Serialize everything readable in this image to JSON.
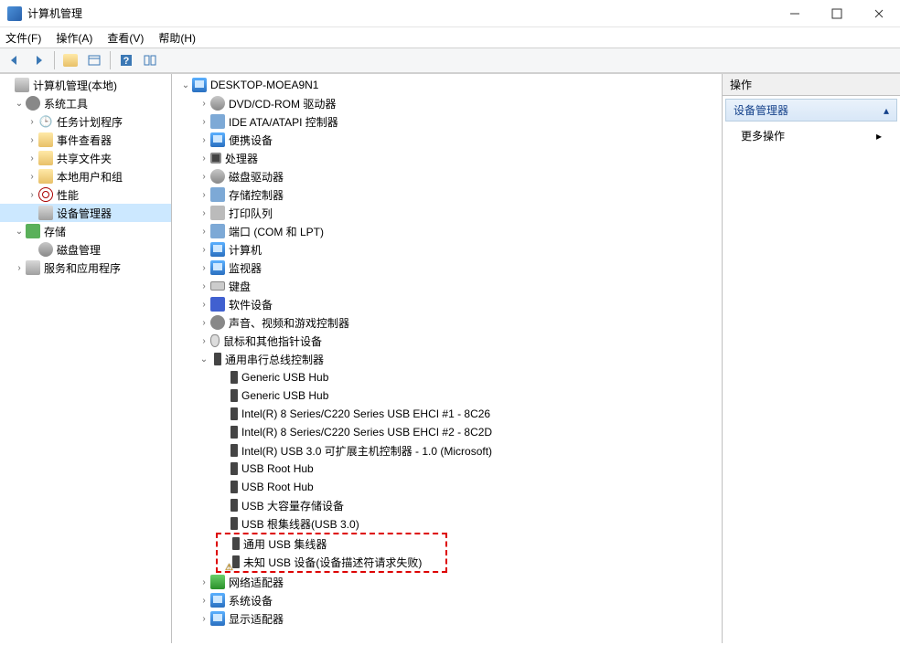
{
  "window": {
    "title": "计算机管理"
  },
  "menu": {
    "file": "文件(F)",
    "action": "操作(A)",
    "view": "查看(V)",
    "help": "帮助(H)"
  },
  "toolbar_icons": {
    "back": "back-arrow",
    "forward": "forward-arrow",
    "up": "up-folder",
    "properties": "properties",
    "help": "help",
    "refresh": "refresh"
  },
  "left_tree": {
    "root": "计算机管理(本地)",
    "system_tools": "系统工具",
    "task_scheduler": "任务计划程序",
    "event_viewer": "事件查看器",
    "shared_folders": "共享文件夹",
    "local_users": "本地用户和组",
    "performance": "性能",
    "device_manager": "设备管理器",
    "storage": "存储",
    "disk_management": "磁盘管理",
    "services": "服务和应用程序"
  },
  "center_tree": {
    "computer_name": "DESKTOP-MOEA9N1",
    "dvd": "DVD/CD-ROM 驱动器",
    "ide": "IDE ATA/ATAPI 控制器",
    "portable": "便携设备",
    "processor": "处理器",
    "disk_drives": "磁盘驱动器",
    "storage_ctrl": "存储控制器",
    "print_queue": "打印队列",
    "ports": "端口 (COM 和 LPT)",
    "computers": "计算机",
    "monitors": "监视器",
    "keyboards": "键盘",
    "software": "软件设备",
    "sound": "声音、视频和游戏控制器",
    "mouse": "鼠标和其他指针设备",
    "usb_ctrl": "通用串行总线控制器",
    "usb_items": {
      "hub1": "Generic USB Hub",
      "hub2": "Generic USB Hub",
      "ehci1": "Intel(R) 8 Series/C220 Series USB EHCI #1 - 8C26",
      "ehci2": "Intel(R) 8 Series/C220 Series USB EHCI #2 - 8C2D",
      "usb3": "Intel(R) USB 3.0 可扩展主机控制器 - 1.0 (Microsoft)",
      "root1": "USB Root Hub",
      "root2": "USB Root Hub",
      "mass": "USB 大容量存储设备",
      "roothub3": "USB 根集线器(USB 3.0)",
      "generic_hub": "通用 USB 集线器",
      "unknown": "未知 USB 设备(设备描述符请求失败)"
    },
    "network": "网络适配器",
    "system_devices": "系统设备",
    "display": "显示适配器"
  },
  "right_pane": {
    "header": "操作",
    "section": "设备管理器",
    "more": "更多操作"
  }
}
